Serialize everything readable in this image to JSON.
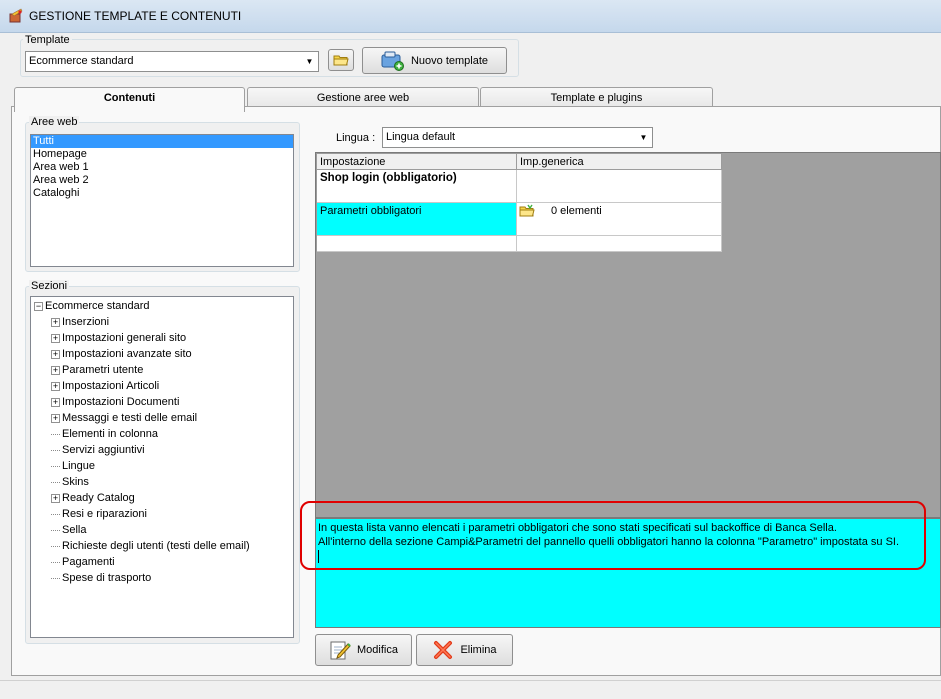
{
  "window": {
    "title": "GESTIONE TEMPLATE E CONTENUTI"
  },
  "template": {
    "legend": "Template",
    "selected": "Ecommerce standard",
    "new_button": "Nuovo template"
  },
  "tabs": [
    {
      "label": "Contenuti"
    },
    {
      "label": "Gestione aree web"
    },
    {
      "label": "Template e plugins"
    }
  ],
  "aree_web": {
    "legend": "Aree web",
    "items": [
      "Tutti",
      "Homepage",
      "Area web 1",
      "Area web 2",
      "Cataloghi"
    ]
  },
  "sezioni": {
    "legend": "Sezioni",
    "root": "Ecommerce standard",
    "items": [
      {
        "label": "Inserzioni",
        "expandable": true
      },
      {
        "label": "Impostazioni generali sito",
        "expandable": true
      },
      {
        "label": "Impostazioni avanzate sito",
        "expandable": true
      },
      {
        "label": "Parametri utente",
        "expandable": true
      },
      {
        "label": "Impostazioni Articoli",
        "expandable": true
      },
      {
        "label": "Impostazioni Documenti",
        "expandable": true
      },
      {
        "label": "Messaggi e testi delle email",
        "expandable": true
      },
      {
        "label": "Elementi in colonna",
        "expandable": false
      },
      {
        "label": "Servizi aggiuntivi",
        "expandable": false
      },
      {
        "label": "Lingue",
        "expandable": false
      },
      {
        "label": "Skins",
        "expandable": false
      },
      {
        "label": "Ready Catalog",
        "expandable": true
      },
      {
        "label": "Resi e riparazioni",
        "expandable": false
      },
      {
        "label": "Sella",
        "expandable": false
      },
      {
        "label": "Richieste degli utenti (testi delle email)",
        "expandable": false
      },
      {
        "label": "Pagamenti",
        "expandable": false
      },
      {
        "label": "Spese di trasporto",
        "expandable": false
      }
    ]
  },
  "lingua": {
    "label": "Lingua :",
    "selected": "Lingua default"
  },
  "grid": {
    "headers": [
      "Impostazione",
      "Imp.generica"
    ],
    "group_title": "Shop login (obbligatorio)",
    "row_label": "Parametri obbligatori",
    "row_value": "0 elementi"
  },
  "description": {
    "line1": "In questa lista vanno elencati i parametri obbligatori che sono stati specificati sul backoffice di Banca Sella.",
    "line2": "All'interno della sezione Campi&Parametri del pannello quelli obbligatori hanno la colonna \"Parametro\" impostata su SI."
  },
  "actions": {
    "modify": "Modifica",
    "delete": "Elimina"
  },
  "colors": {
    "selection": "#3399ff",
    "cyan": "#00ffff",
    "highlight_frame": "#e00000"
  }
}
